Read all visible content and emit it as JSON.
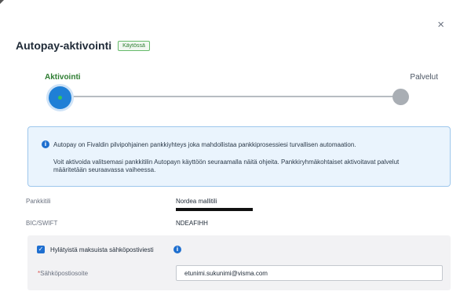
{
  "dialog": {
    "close_glyph": "×",
    "title": "Autopay-aktivointi",
    "status_badge": "Käytössä"
  },
  "stepper": {
    "steps": [
      {
        "label": "Aktivointi",
        "state": "active"
      },
      {
        "label": "Palvelut",
        "state": "pending"
      }
    ],
    "active_color": "#1f7fd6",
    "inactive_color": "#a9aeb4"
  },
  "info": {
    "icon": "info-icon",
    "line1": "Autopay on Fivaldin pilvipohjainen pankkiyhteys joka mahdollistaa pankkiprosessiesi turvallisen automaation.",
    "line2": "Voit aktivoida valitsemasi pankkitilin Autopayn käyttöön seuraamalla näitä ohjeita. Pankkiryhmäkohtaiset aktivoitavat palvelut määritetään seuraavassa vaiheessa."
  },
  "account": {
    "label": "Pankkitili",
    "name": "Nordea mallitili",
    "number_redacted": true
  },
  "bic": {
    "label": "BIC/SWIFT",
    "value": "NDEAFIHH"
  },
  "rejected": {
    "checkbox_label": "Hylätyistä maksuista sähköpostiviesti",
    "checked": true,
    "email_label_required": "*",
    "email_label": "Sähköpostiosoite",
    "email_value": "etunimi.sukunimi@visma.com"
  }
}
